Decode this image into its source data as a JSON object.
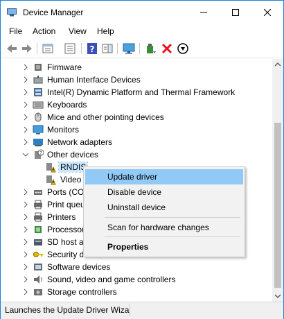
{
  "window": {
    "title": "Device Manager"
  },
  "menubar": {
    "items": [
      "File",
      "Action",
      "View",
      "Help"
    ]
  },
  "toolbar": {
    "buttons": [
      "back-arrow-icon",
      "forward-arrow-icon",
      "properties-sheet-icon",
      "console-tree-icon",
      "help-icon",
      "action-pane-icon",
      "monitor-scan-icon",
      "update-driver-icon",
      "uninstall-device-icon",
      "disable-device-icon"
    ]
  },
  "tree": {
    "items": [
      {
        "label": "Firmware"
      },
      {
        "label": "Human Interface Devices"
      },
      {
        "label": "Intel(R) Dynamic Platform and Thermal Framework"
      },
      {
        "label": "Keyboards"
      },
      {
        "label": "Mice and other pointing devices"
      },
      {
        "label": "Monitors"
      },
      {
        "label": "Network adapters"
      },
      {
        "label": "Other devices"
      },
      {
        "label": "RNDIS"
      },
      {
        "label": "Video"
      },
      {
        "label": "Ports (CO"
      },
      {
        "label": "Print queu"
      },
      {
        "label": "Printers"
      },
      {
        "label": "Processor"
      },
      {
        "label": "SD host ad"
      },
      {
        "label": "Security devices"
      },
      {
        "label": "Software devices"
      },
      {
        "label": "Sound, video and game controllers"
      },
      {
        "label": "Storage controllers"
      }
    ]
  },
  "context_menu": {
    "items": [
      {
        "label": "Update driver"
      },
      {
        "label": "Disable device"
      },
      {
        "label": "Uninstall device"
      },
      {
        "label": "Scan for hardware changes"
      },
      {
        "label": "Properties"
      }
    ]
  },
  "statusbar": {
    "text": "Launches the Update Driver Wizard"
  },
  "colors": {
    "accent": "#1883d7",
    "selection": "#cce8ff",
    "menu_hover": "#91c9f7",
    "warning": "#f0c000",
    "uninstall_red": "#e81123"
  }
}
